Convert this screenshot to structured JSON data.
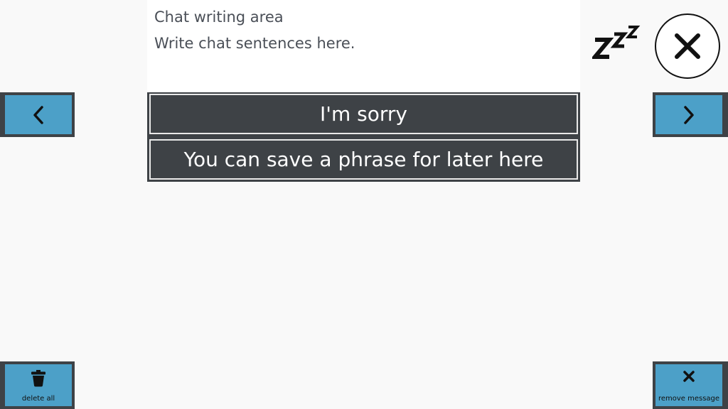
{
  "writing_area": {
    "title": "Chat writing area",
    "hint": "Write chat sentences here."
  },
  "phrases": [
    {
      "label": "I'm sorry"
    },
    {
      "label": "You can save a phrase for later here"
    }
  ],
  "nav": {
    "prev_icon": "chevron-left-icon",
    "next_icon": "chevron-right-icon"
  },
  "top_controls": {
    "sleep_icon": "sleep-zzz-icon",
    "close_icon": "close-icon"
  },
  "corner_buttons": {
    "delete_all_label": "delete all",
    "remove_message_label": "remove message"
  },
  "colors": {
    "button_blue": "#4ca0c8",
    "panel_dark": "#3e4246",
    "background": "#f9f9f9"
  }
}
